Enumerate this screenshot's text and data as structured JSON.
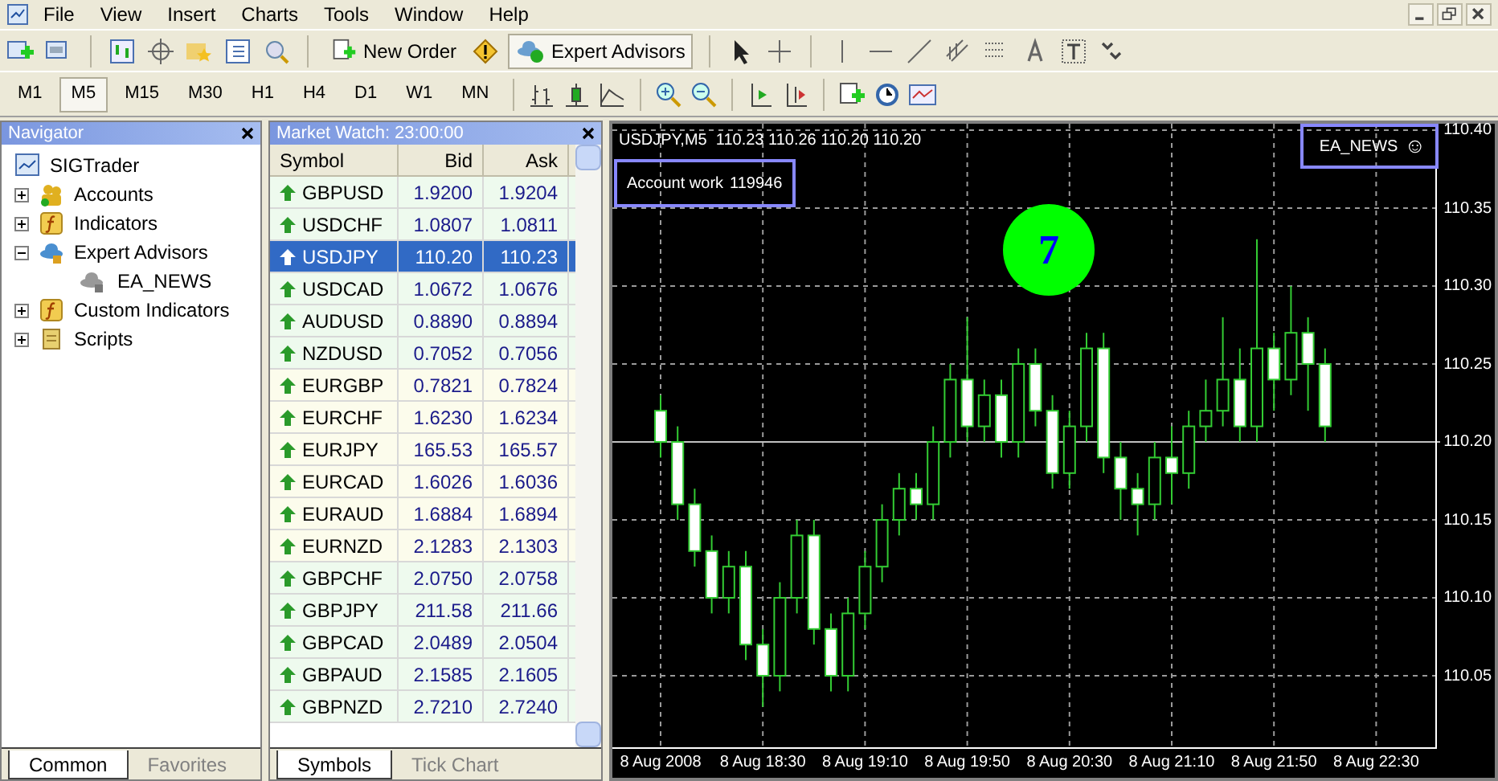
{
  "menu": [
    "File",
    "View",
    "Insert",
    "Charts",
    "Tools",
    "Window",
    "Help"
  ],
  "toolbar": {
    "new_order": "New Order",
    "expert_advisors": "Expert Advisors",
    "expert_advisors_on": true
  },
  "timeframes": [
    {
      "label": "M1",
      "selected": false
    },
    {
      "label": "M5",
      "selected": true
    },
    {
      "label": "M15",
      "selected": false
    },
    {
      "label": "M30",
      "selected": false
    },
    {
      "label": "H1",
      "selected": false
    },
    {
      "label": "H4",
      "selected": false
    },
    {
      "label": "D1",
      "selected": false
    },
    {
      "label": "W1",
      "selected": false
    },
    {
      "label": "MN",
      "selected": false
    }
  ],
  "navigator": {
    "title": "Navigator",
    "root": "SIGTrader",
    "items": [
      {
        "label": "Accounts",
        "kind": "accounts",
        "expanded": false
      },
      {
        "label": "Indicators",
        "kind": "indicators",
        "expanded": false
      },
      {
        "label": "Expert Advisors",
        "kind": "experts",
        "expanded": true,
        "children": [
          {
            "label": "EA_NEWS"
          }
        ]
      },
      {
        "label": "Custom Indicators",
        "kind": "custom",
        "expanded": false
      },
      {
        "label": "Scripts",
        "kind": "scripts",
        "expanded": false
      }
    ],
    "tabs": [
      {
        "label": "Common",
        "selected": true
      },
      {
        "label": "Favorites",
        "selected": false
      }
    ]
  },
  "market_watch": {
    "title": "Market Watch: 23:00:00",
    "columns": [
      "Symbol",
      "Bid",
      "Ask"
    ],
    "rows": [
      {
        "symbol": "GBPUSD",
        "bid": "1.9200",
        "ask": "1.9204",
        "selected": false
      },
      {
        "symbol": "USDCHF",
        "bid": "1.0807",
        "ask": "1.0811",
        "selected": false
      },
      {
        "symbol": "USDJPY",
        "bid": "110.20",
        "ask": "110.23",
        "selected": true
      },
      {
        "symbol": "USDCAD",
        "bid": "1.0672",
        "ask": "1.0676",
        "selected": false
      },
      {
        "symbol": "AUDUSD",
        "bid": "0.8890",
        "ask": "0.8894",
        "selected": false
      },
      {
        "symbol": "NZDUSD",
        "bid": "0.7052",
        "ask": "0.7056",
        "selected": false
      },
      {
        "symbol": "EURGBP",
        "bid": "0.7821",
        "ask": "0.7824",
        "selected": false
      },
      {
        "symbol": "EURCHF",
        "bid": "1.6230",
        "ask": "1.6234",
        "selected": false
      },
      {
        "symbol": "EURJPY",
        "bid": "165.53",
        "ask": "165.57",
        "selected": false
      },
      {
        "symbol": "EURCAD",
        "bid": "1.6026",
        "ask": "1.6036",
        "selected": false
      },
      {
        "symbol": "EURAUD",
        "bid": "1.6884",
        "ask": "1.6894",
        "selected": false
      },
      {
        "symbol": "EURNZD",
        "bid": "2.1283",
        "ask": "2.1303",
        "selected": false
      },
      {
        "symbol": "GBPCHF",
        "bid": "2.0750",
        "ask": "2.0758",
        "selected": false
      },
      {
        "symbol": "GBPJPY",
        "bid": "211.58",
        "ask": "211.66",
        "selected": false
      },
      {
        "symbol": "GBPCAD",
        "bid": "2.0489",
        "ask": "2.0504",
        "selected": false
      },
      {
        "symbol": "GBPAUD",
        "bid": "2.1585",
        "ask": "2.1605",
        "selected": false
      },
      {
        "symbol": "GBPNZD",
        "bid": "2.7210",
        "ask": "2.7240",
        "selected": false
      }
    ],
    "tabs": [
      {
        "label": "Symbols",
        "selected": true
      },
      {
        "label": "Tick Chart",
        "selected": false
      }
    ]
  },
  "chart": {
    "header": "USDJPY,M5  110.23 110.26 110.20 110.20",
    "account_label": "Account work",
    "account_value": "119946",
    "badge": "7",
    "ea_name": "EA_NEWS",
    "ea_smiley": "☺",
    "chart_data": {
      "type": "candlestick",
      "categories": [
        "8 Aug 2008",
        null,
        null,
        null,
        null,
        null,
        "8 Aug 18:30",
        null,
        null,
        null,
        null,
        null,
        "8 Aug 19:10",
        null,
        null,
        null,
        null,
        null,
        "8 Aug 19:50",
        null,
        null,
        null,
        null,
        null,
        "8 Aug 20:30",
        null,
        null,
        null,
        null,
        null,
        "8 Aug 21:10",
        null,
        null,
        null,
        null,
        null,
        "8 Aug 21:50",
        null,
        null,
        null,
        null,
        null,
        "8 Aug 22:30",
        null,
        null,
        null
      ],
      "ohlc": [
        [
          110.22,
          110.23,
          110.19,
          110.2
        ],
        [
          110.2,
          110.21,
          110.15,
          110.16
        ],
        [
          110.16,
          110.17,
          110.12,
          110.13
        ],
        [
          110.13,
          110.14,
          110.09,
          110.1
        ],
        [
          110.1,
          110.13,
          110.09,
          110.12
        ],
        [
          110.12,
          110.13,
          110.06,
          110.07
        ],
        [
          110.07,
          110.08,
          110.03,
          110.05
        ],
        [
          110.05,
          110.11,
          110.04,
          110.1
        ],
        [
          110.1,
          110.15,
          110.09,
          110.14
        ],
        [
          110.14,
          110.15,
          110.07,
          110.08
        ],
        [
          110.08,
          110.09,
          110.04,
          110.05
        ],
        [
          110.05,
          110.1,
          110.04,
          110.09
        ],
        [
          110.09,
          110.13,
          110.08,
          110.12
        ],
        [
          110.12,
          110.16,
          110.11,
          110.15
        ],
        [
          110.15,
          110.18,
          110.14,
          110.17
        ],
        [
          110.17,
          110.18,
          110.15,
          110.16
        ],
        [
          110.16,
          110.21,
          110.15,
          110.2
        ],
        [
          110.2,
          110.25,
          110.19,
          110.24
        ],
        [
          110.24,
          110.28,
          110.2,
          110.21
        ],
        [
          110.21,
          110.24,
          110.2,
          110.23
        ],
        [
          110.23,
          110.24,
          110.19,
          110.2
        ],
        [
          110.2,
          110.26,
          110.19,
          110.25
        ],
        [
          110.25,
          110.26,
          110.21,
          110.22
        ],
        [
          110.22,
          110.23,
          110.17,
          110.18
        ],
        [
          110.18,
          110.22,
          110.17,
          110.21
        ],
        [
          110.21,
          110.27,
          110.2,
          110.26
        ],
        [
          110.26,
          110.27,
          110.18,
          110.19
        ],
        [
          110.19,
          110.2,
          110.15,
          110.17
        ],
        [
          110.17,
          110.18,
          110.14,
          110.16
        ],
        [
          110.16,
          110.2,
          110.15,
          110.19
        ],
        [
          110.19,
          110.21,
          110.16,
          110.18
        ],
        [
          110.18,
          110.22,
          110.17,
          110.21
        ],
        [
          110.21,
          110.24,
          110.2,
          110.22
        ],
        [
          110.22,
          110.28,
          110.21,
          110.24
        ],
        [
          110.24,
          110.26,
          110.2,
          110.21
        ],
        [
          110.21,
          110.33,
          110.2,
          110.26
        ],
        [
          110.26,
          110.27,
          110.22,
          110.24
        ],
        [
          110.24,
          110.3,
          110.23,
          110.27
        ],
        [
          110.27,
          110.28,
          110.22,
          110.25
        ],
        [
          110.25,
          110.26,
          110.2,
          110.21
        ],
        null,
        null,
        null,
        null,
        null,
        null
      ],
      "ylim": [
        110.0,
        110.4
      ],
      "grid": true,
      "ref_lines": [
        {
          "axis": "y",
          "value": 110.2
        }
      ],
      "yticks": [
        {
          "value": 110.4,
          "label": "110.40"
        },
        {
          "value": 110.35,
          "label": "110.35"
        },
        {
          "value": 110.3,
          "label": "110.30"
        },
        {
          "value": 110.25,
          "label": "110.25"
        },
        {
          "value": 110.2,
          "label": "110.20"
        },
        {
          "value": 110.15,
          "label": "110.15"
        },
        {
          "value": 110.1,
          "label": "110.10"
        },
        {
          "value": 110.05,
          "label": "110.05"
        }
      ]
    }
  }
}
